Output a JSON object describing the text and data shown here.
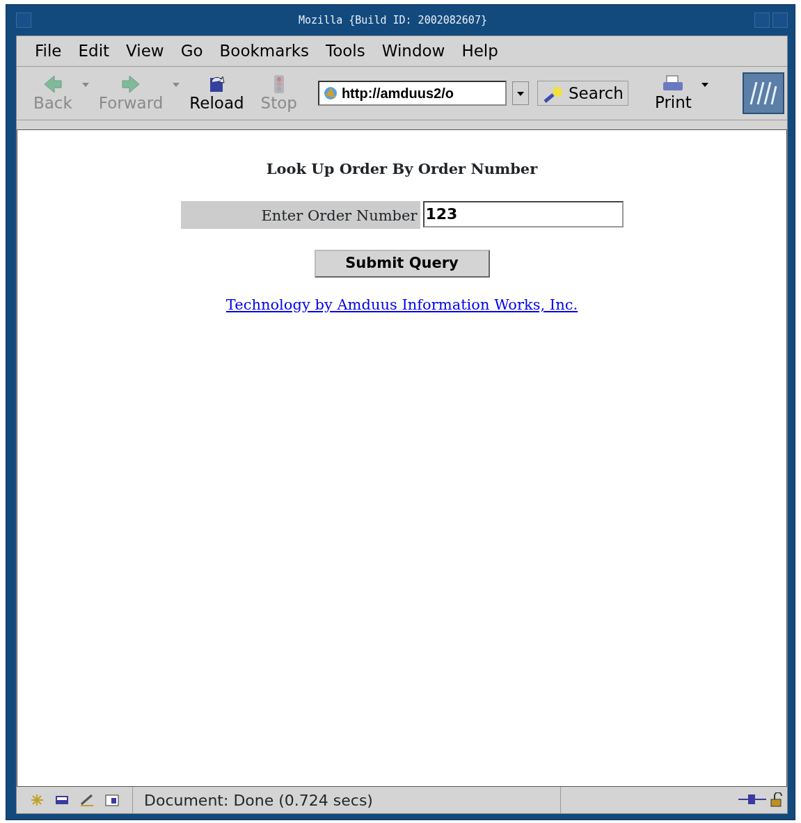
{
  "window": {
    "title": "Mozilla {Build ID: 2002082607}"
  },
  "menu": [
    "File",
    "Edit",
    "View",
    "Go",
    "Bookmarks",
    "Tools",
    "Window",
    "Help"
  ],
  "toolbar": [
    {
      "label": "Back",
      "kind": "back",
      "disabled": true,
      "dropdown": true
    },
    {
      "label": "Forward",
      "kind": "forward",
      "disabled": true,
      "dropdown": true
    },
    {
      "label": "Reload",
      "kind": "reload",
      "disabled": false,
      "dropdown": false
    },
    {
      "label": "Stop",
      "kind": "stop",
      "disabled": true,
      "dropdown": false
    }
  ],
  "address": {
    "value": "http://amduus2/o"
  },
  "search_button": "Search",
  "print": {
    "label": "Print",
    "disabled": false,
    "dropdown": true
  },
  "page": {
    "heading": "Look Up Order By Order Number",
    "field_label": "Enter Order Number",
    "field_value": "123",
    "submit": "Submit Query",
    "link": "Technology by Amduus Information Works, Inc."
  },
  "status_bar": {
    "text": "Document: Done (0.724 secs)"
  }
}
